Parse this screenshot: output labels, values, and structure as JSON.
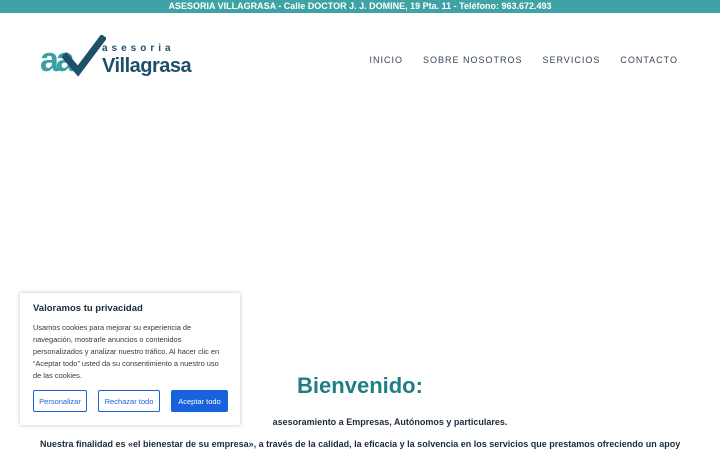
{
  "topbar": {
    "text": "ASESORIA VILLAGRASA - Calle DOCTOR J. J. DOMINE, 19 Pta. 11 - Teléfono: 963.672.493"
  },
  "logo": {
    "letters": "aa",
    "top_text": "asesoria",
    "bottom_text": "Villagrasa"
  },
  "nav": {
    "items": [
      "INICIO",
      "SOBRE NOSOTROS",
      "SERVICIOS",
      "CONTACTO"
    ]
  },
  "main": {
    "welcome": "Bienvenido:",
    "intro_visible": "asesoramiento a Empresas, Autónomos y particulares.",
    "paragraph": "Nuestra finalidad es «el bienestar de su empresa», a través de la calidad, la eficacia y la solvencia en los servicios que prestamos ofreciendo un apoyo"
  },
  "cookie": {
    "title": "Valoramos tu privacidad",
    "text": "Usamos cookies para mejorar su experiencia de navegación, mostrarle anuncios o contenidos personalizados y analizar nuestro tráfico. Al hacer clic en “Aceptar todo” usted da su consentimiento a nuestro uso de las cookies.",
    "customize": "Personalizar",
    "reject": "Rechazar todo",
    "accept": "Aceptar todo"
  },
  "colors": {
    "teal": "#3fa3a6",
    "navy": "#1f4f6b",
    "accent_blue": "#1863dc"
  }
}
